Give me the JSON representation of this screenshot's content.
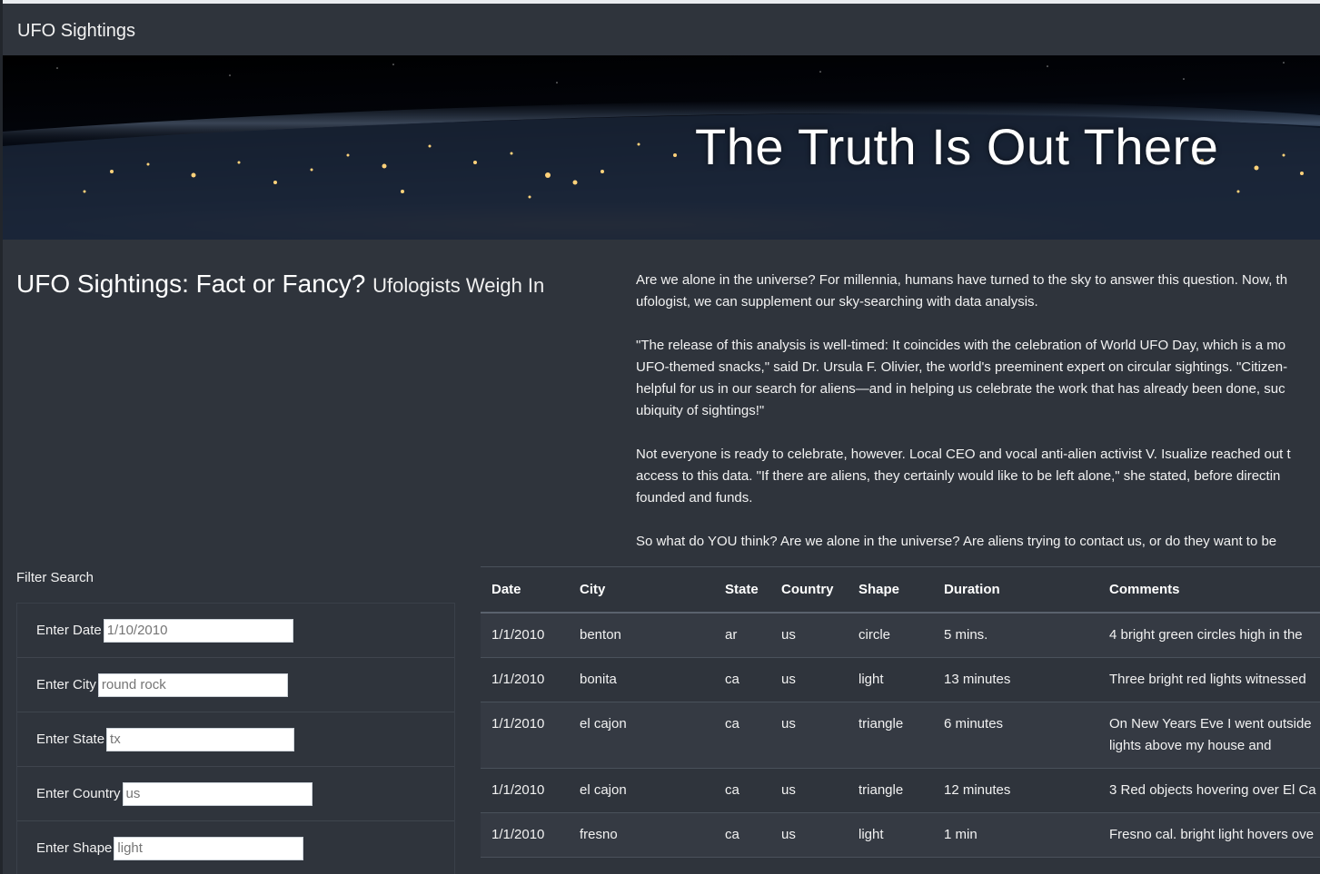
{
  "navbar": {
    "brand": "UFO Sightings"
  },
  "hero": {
    "title": "The Truth Is Out There"
  },
  "article": {
    "heading": "UFO Sightings: Fact or Fancy?",
    "subheading": "Ufologists Weigh In",
    "paragraphs": [
      [
        "Are we alone in the universe? For millennia, humans have turned to the sky to answer this question. Now, th",
        "ufologist, we can supplement our sky-searching with data analysis."
      ],
      [
        "\"The release of this analysis is well-timed: It coincides with the celebration of World UFO Day, which is a mo",
        "UFO-themed snacks,\" said Dr. Ursula F. Olivier, the world's preeminent expert on circular sightings. \"Citizen-",
        "helpful for us in our search for aliens—and in helping us celebrate the work that has already been done, suc",
        "ubiquity of sightings!\""
      ],
      [
        "Not everyone is ready to celebrate, however. Local CEO and vocal anti-alien activist V. Isualize reached out t",
        "access to this data. \"If there are aliens, they certainly would like to be left alone,\" she stated, before directin",
        "founded and funds."
      ],
      [
        "So what do YOU think? Are we alone in the universe? Are aliens trying to contact us, or do they want to be"
      ]
    ]
  },
  "filters": {
    "title": "Filter Search",
    "items": [
      {
        "label": "Enter Date",
        "placeholder": "1/10/2010"
      },
      {
        "label": "Enter City",
        "placeholder": "round rock"
      },
      {
        "label": "Enter State",
        "placeholder": "tx"
      },
      {
        "label": "Enter Country",
        "placeholder": "us"
      },
      {
        "label": "Enter Shape",
        "placeholder": "light"
      }
    ]
  },
  "table": {
    "headers": [
      "Date",
      "City",
      "State",
      "Country",
      "Shape",
      "Duration",
      "Comments"
    ],
    "rows": [
      [
        "1/1/2010",
        "benton",
        "ar",
        "us",
        "circle",
        "5 mins.",
        "4 bright green circles high in the"
      ],
      [
        "1/1/2010",
        "bonita",
        "ca",
        "us",
        "light",
        "13 minutes",
        "Three bright red lights witnessed"
      ],
      [
        "1/1/2010",
        "el cajon",
        "ca",
        "us",
        "triangle",
        "6 minutes",
        "On New Years Eve I went outside\nlights above my house and"
      ],
      [
        "1/1/2010",
        "el cajon",
        "ca",
        "us",
        "triangle",
        "12 minutes",
        "3 Red objects hovering over El Ca"
      ],
      [
        "1/1/2010",
        "fresno",
        "ca",
        "us",
        "light",
        "1 min",
        "Fresno cal. bright light hovers ove"
      ]
    ]
  }
}
